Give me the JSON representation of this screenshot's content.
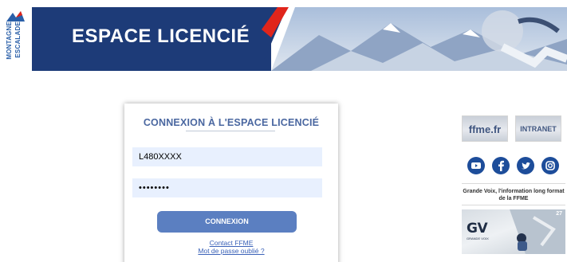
{
  "banner": {
    "title": "ESPACE LICENCIÉ",
    "logo_words": [
      "MONTAGNE",
      "ESCALADE"
    ]
  },
  "login": {
    "title": "CONNEXION À L'ESPACE LICENCIÉ",
    "username_value": "L480XXXX",
    "password_value": "••••••••",
    "submit_label": "CONNEXION",
    "contact_link": "Contact FFME",
    "forgot_link": "Mot de passe oublié ?"
  },
  "sidebar": {
    "ffme_label": "ffme.fr",
    "intranet_label": "INTRANET",
    "social_icons": [
      "youtube-icon",
      "facebook-icon",
      "twitter-icon",
      "instagram-icon"
    ],
    "caption": "Grande Voix, l'information long format de la FFME",
    "promo_title": "GV",
    "promo_subtitle": "GRANDE VOIX",
    "promo_issue": "27"
  },
  "colors": {
    "navy": "#1d3b78",
    "accent_blue": "#5b7fc1",
    "title_blue": "#4a67a0",
    "field_bg": "#e8f0fe",
    "social_blue": "#1d4d9a",
    "red": "#e0251b"
  }
}
